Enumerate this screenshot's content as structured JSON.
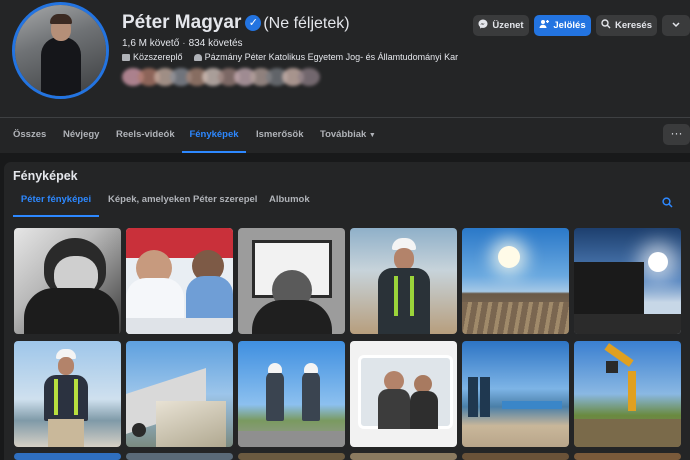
{
  "profile": {
    "name": "Péter Magyar",
    "nickname": "(Ne féljetek)",
    "followers": "1,6 M követő",
    "following": "834 követés",
    "role": "Közszereplő",
    "education": "Pázmány Péter Katolikus Egyetem Jog- és Államtudományi Kar"
  },
  "actions": {
    "message": "Üzenet",
    "tag": "Jelölés",
    "search": "Keresés"
  },
  "tabs": [
    {
      "label": "Összes"
    },
    {
      "label": "Névjegy"
    },
    {
      "label": "Reels-videók"
    },
    {
      "label": "Fényképek"
    },
    {
      "label": "Ismerősök"
    },
    {
      "label": "Továbbiak"
    }
  ],
  "photos_section": {
    "title": "Fényképek",
    "subtabs": [
      {
        "label": "Péter fényképei"
      },
      {
        "label": "Képek, amelyeken Péter szerepel"
      },
      {
        "label": "Albumok"
      }
    ]
  },
  "colors": {
    "accent": "#2d88ff",
    "primary_button": "#2374e1",
    "background": "#18191a",
    "surface": "#242526"
  },
  "icons": [
    "verified-badge-icon",
    "messenger-icon",
    "add-person-icon",
    "search-icon",
    "chevron-down-icon",
    "more-dots-icon",
    "briefcase-icon",
    "graduation-cap-icon"
  ]
}
